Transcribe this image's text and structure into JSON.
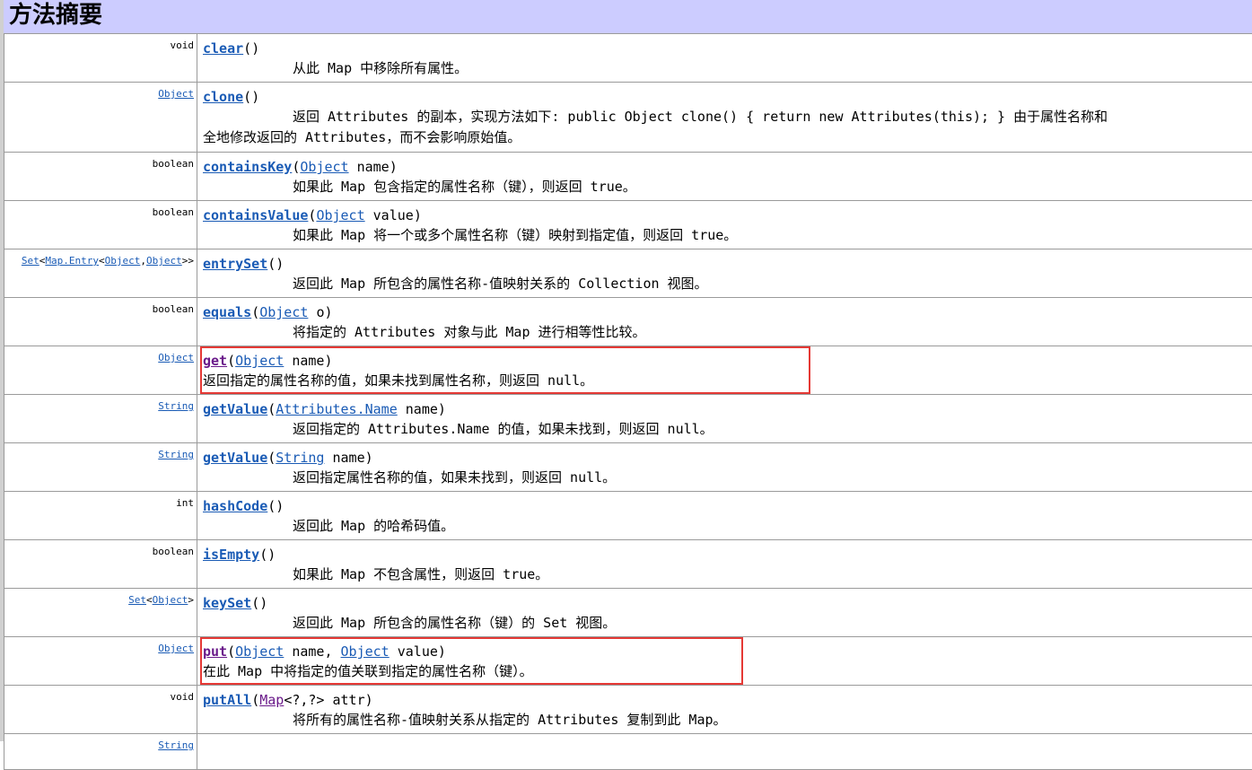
{
  "header": {
    "title": "方法摘要"
  },
  "rows": [
    {
      "type": [
        {
          "t": "void",
          "link": false
        }
      ],
      "name": "clear",
      "params": [],
      "desc": "从此 Map 中移除所有属性。"
    },
    {
      "type": [
        {
          "t": "Object",
          "link": true
        }
      ],
      "name": "clone",
      "params": [],
      "desc": "返回 Attributes 的副本，实现方法如下: public Object clone() { return new Attributes(this); } 由于属性名称和",
      "desc2": "全地修改返回的 Attributes，而不会影响原始值。"
    },
    {
      "type": [
        {
          "t": "boolean",
          "link": false
        }
      ],
      "name": "containsKey",
      "params": [
        {
          "type": "Object",
          "name": "name"
        }
      ],
      "desc": "如果此 Map 包含指定的属性名称（键），则返回 true。"
    },
    {
      "type": [
        {
          "t": "boolean",
          "link": false
        }
      ],
      "name": "containsValue",
      "params": [
        {
          "type": "Object",
          "name": "value"
        }
      ],
      "desc": "如果此 Map 将一个或多个属性名称（键）映射到指定值，则返回 true。"
    },
    {
      "type": [
        {
          "t": "Set",
          "link": true
        },
        {
          "t": "<",
          "link": false
        },
        {
          "t": "Map.Entry",
          "link": true
        },
        {
          "t": "<",
          "link": false
        },
        {
          "t": "Object",
          "link": true
        },
        {
          "t": ",",
          "link": false
        },
        {
          "t": "Object",
          "link": true
        },
        {
          "t": ">>",
          "link": false
        }
      ],
      "name": "entrySet",
      "params": [],
      "desc": "返回此 Map 所包含的属性名称-值映射关系的 Collection 视图。"
    },
    {
      "type": [
        {
          "t": "boolean",
          "link": false
        }
      ],
      "name": "equals",
      "params": [
        {
          "type": "Object",
          "name": "o"
        }
      ],
      "desc": "将指定的 Attributes 对象与此 Map 进行相等性比较。"
    },
    {
      "type": [
        {
          "t": "Object",
          "link": true
        }
      ],
      "name": "get",
      "params": [
        {
          "type": "Object",
          "name": "name"
        }
      ],
      "desc": "返回指定的属性名称的值，如果未找到属性名称，则返回 null。",
      "visited": true,
      "highlight": true
    },
    {
      "type": [
        {
          "t": "String",
          "link": true
        }
      ],
      "name": "getValue",
      "params": [
        {
          "type": "Attributes.Name",
          "name": "name"
        }
      ],
      "desc": "返回指定的 Attributes.Name 的值，如果未找到，则返回 null。"
    },
    {
      "type": [
        {
          "t": "String",
          "link": true
        }
      ],
      "name": "getValue",
      "params": [
        {
          "type": "String",
          "name": "name"
        }
      ],
      "desc": "返回指定属性名称的值，如果未找到，则返回 null。"
    },
    {
      "type": [
        {
          "t": "int",
          "link": false
        }
      ],
      "name": "hashCode",
      "params": [],
      "desc": "返回此 Map 的哈希码值。"
    },
    {
      "type": [
        {
          "t": "boolean",
          "link": false
        }
      ],
      "name": "isEmpty",
      "params": [],
      "desc": "如果此 Map 不包含属性，则返回 true。"
    },
    {
      "type": [
        {
          "t": "Set",
          "link": true
        },
        {
          "t": "<",
          "link": false
        },
        {
          "t": "Object",
          "link": true
        },
        {
          "t": ">",
          "link": false
        }
      ],
      "name": "keySet",
      "params": [],
      "desc": "返回此 Map 所包含的属性名称（键）的 Set 视图。"
    },
    {
      "type": [
        {
          "t": "Object",
          "link": true
        }
      ],
      "name": "put",
      "params": [
        {
          "type": "Object",
          "name": "name"
        },
        {
          "type": "Object",
          "name": "value"
        }
      ],
      "desc": "在此 Map 中将指定的值关联到指定的属性名称（键）。",
      "visited": true,
      "highlight": true
    },
    {
      "type": [
        {
          "t": "void",
          "link": false
        }
      ],
      "name": "putAll",
      "params": [
        {
          "type": "Map",
          "name": "attr",
          "generic": "<?,?>"
        }
      ],
      "desc": "将所有的属性名称-值映射关系从指定的 Attributes 复制到此 Map。"
    },
    {
      "type": [
        {
          "t": "String",
          "link": true
        }
      ],
      "name": "",
      "params": [],
      "desc": ""
    }
  ]
}
